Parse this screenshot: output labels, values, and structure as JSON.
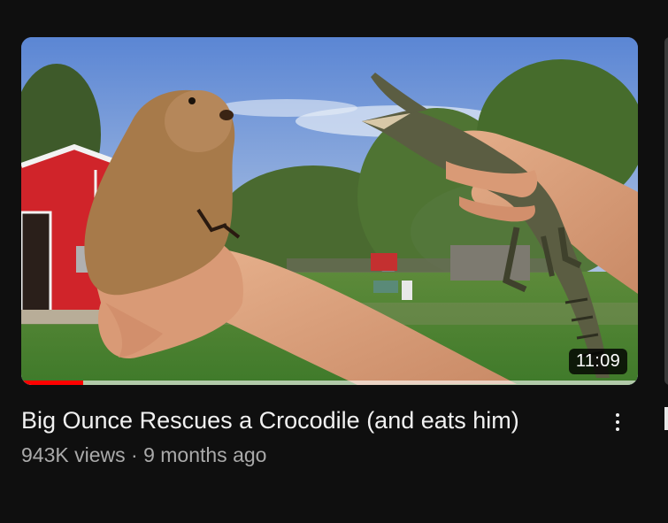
{
  "video": {
    "title": "Big Ounce Rescues a Crocodile (and eats him)",
    "duration": "11:09",
    "views": "943K views",
    "separator": "·",
    "published": "9 months ago",
    "watch_progress": 0.1
  },
  "icons": {
    "more": "more-vert-icon"
  },
  "colors": {
    "background": "#0f0f0f",
    "progress": "#ff0000",
    "title": "#f1f1f1",
    "meta": "#aaaaaa"
  }
}
